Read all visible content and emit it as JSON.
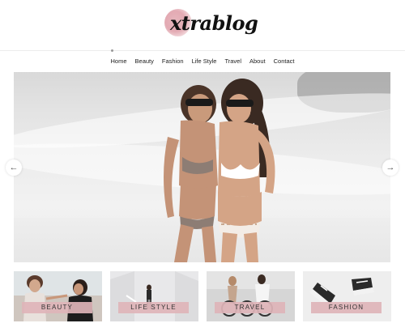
{
  "brand": {
    "logo_text": "xtrablog"
  },
  "nav": {
    "items": [
      "Home",
      "Beauty",
      "Fashion",
      "Life Style",
      "Travel",
      "About",
      "Contact"
    ]
  },
  "slider": {
    "prev_glyph": "←",
    "next_glyph": "→"
  },
  "categories": [
    {
      "label": "BEAUTY"
    },
    {
      "label": "LIFE STYLE"
    },
    {
      "label": "TRAVEL"
    },
    {
      "label": "FASHION"
    }
  ],
  "colors": {
    "accent_pink": "#deb4b9",
    "background": "#ffffff"
  }
}
